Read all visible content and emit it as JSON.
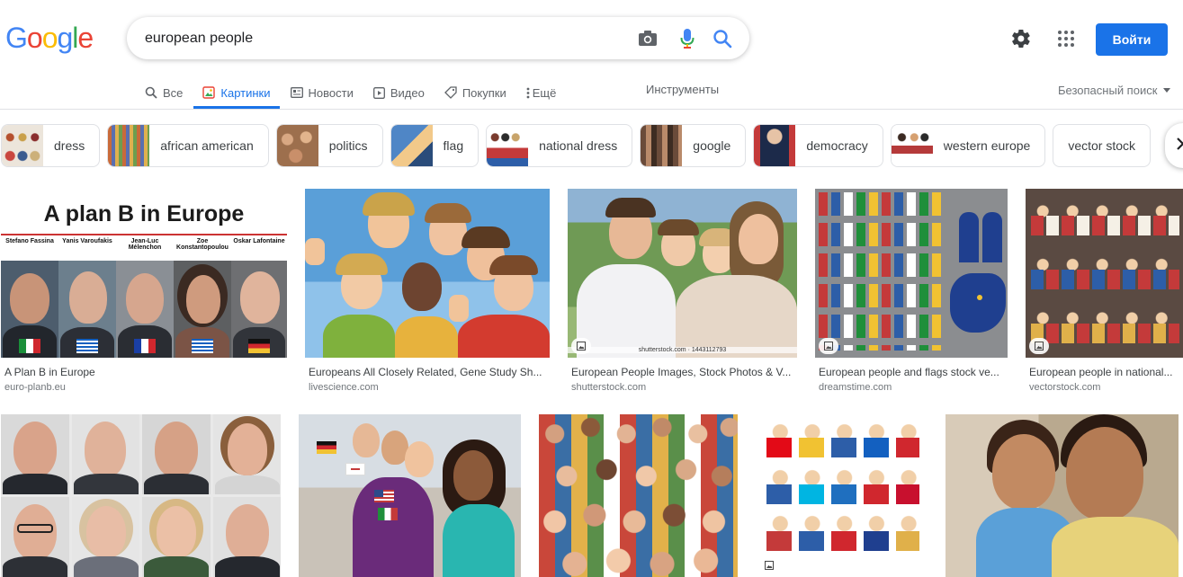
{
  "logo": {
    "letters": [
      "G",
      "o",
      "o",
      "g",
      "l",
      "e"
    ],
    "colors": [
      "#4285f4",
      "#ea4335",
      "#fbbc05",
      "#4285f4",
      "#34a853",
      "#ea4335"
    ]
  },
  "search": {
    "query": "european people"
  },
  "header": {
    "signin_label": "Войти"
  },
  "tabs": [
    {
      "label": "Все",
      "icon": "search-icon"
    },
    {
      "label": "Картинки",
      "icon": "image-icon",
      "active": true
    },
    {
      "label": "Новости",
      "icon": "news-icon"
    },
    {
      "label": "Видео",
      "icon": "video-icon"
    },
    {
      "label": "Покупки",
      "icon": "tag-icon"
    },
    {
      "label": "Ещё",
      "icon": "more-vert-icon"
    }
  ],
  "tools_label": "Инструменты",
  "safesearch_label": "Безопасный поиск",
  "chips": [
    {
      "label": "dress"
    },
    {
      "label": "african american"
    },
    {
      "label": "politics"
    },
    {
      "label": "flag"
    },
    {
      "label": "national dress"
    },
    {
      "label": "google"
    },
    {
      "label": "democracy"
    },
    {
      "label": "western europe"
    },
    {
      "label": "vector stock"
    }
  ],
  "results_row1": [
    {
      "title": "A Plan B in Europe",
      "source": "euro-planb.eu",
      "banner": "A plan B in Europe",
      "names": [
        "Stefano Fassina",
        "Yanis Varoufakis",
        "Jean-Luc Mélenchon",
        "Zoe Konstantopoulou",
        "Oskar Lafontaine"
      ]
    },
    {
      "title": "Europeans All Closely Related, Gene Study Sh...",
      "source": "livescience.com"
    },
    {
      "title": "European People Images, Stock Photos & V...",
      "source": "shutterstock.com",
      "watermark": "shutterstock.com · 1443112793"
    },
    {
      "title": "European people and flags stock ve...",
      "source": "dreamstime.com"
    },
    {
      "title": "European people in national...",
      "source": "vectorstock.com"
    }
  ],
  "colors": {
    "accent": "#1a73e8",
    "chip_border": "#dfe1e5",
    "muted": "#70757a"
  }
}
